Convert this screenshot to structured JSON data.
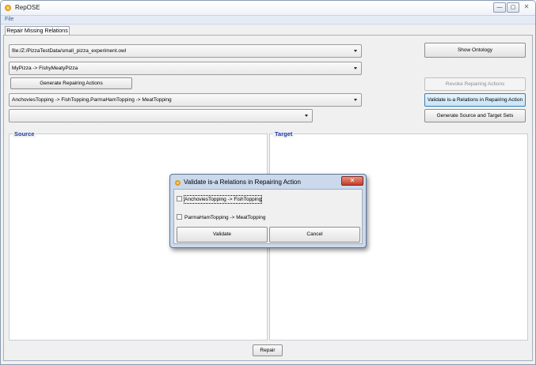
{
  "window": {
    "title": "RepOSE",
    "controls": {
      "minimize": "—",
      "maximize": "▢",
      "close": "✕"
    }
  },
  "menu": {
    "file": "File"
  },
  "tabs": [
    {
      "label": "Repair Missing Relations",
      "active": true
    }
  ],
  "main": {
    "ontology_combo": {
      "value": "file:/Z:/PizzaTestData/small_pizza_experiment.owl"
    },
    "relation_combo": {
      "value": "MyPizza -> FishyMeatyPizza"
    },
    "actions_combo": {
      "value": "AnchoviesTopping -> FishTopping,ParmaHamTopping -> MeatTopping"
    },
    "empty_combo": {
      "value": ""
    },
    "buttons": {
      "show_ontology": "Show Ontology",
      "generate_repairing_actions": "Generate Repairing Actions",
      "revoke_repairing_actions": "Revoke Repairing Actions",
      "validate_isa": "Validate is-a Relations in Repairing Action",
      "generate_source_target": "Generate Source and Target Sets",
      "repair": "Repair"
    },
    "source_label": "Source",
    "target_label": "Target"
  },
  "dialog": {
    "title": "Validate is-a Relations in Repairing Action",
    "close": "✕",
    "checkboxes": [
      {
        "label": "AnchoviesTopping -> FishTopping",
        "checked": false
      },
      {
        "label": "ParmaHamTopping -> MeatTopping",
        "checked": false
      }
    ],
    "validate": "Validate",
    "cancel": "Cancel"
  },
  "colors": {
    "group_label": "#1c3aa8",
    "dialog_frame": "#cad9ec",
    "close_button": "#c13d2b"
  }
}
